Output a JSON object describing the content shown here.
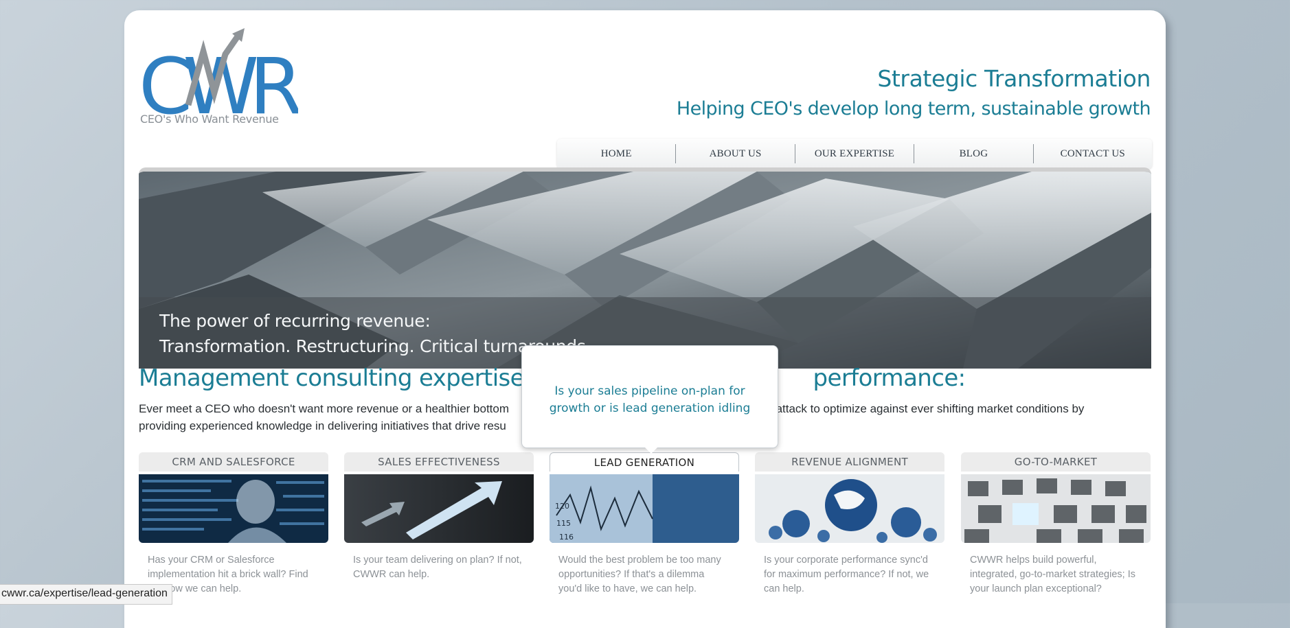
{
  "logo": {
    "letters": "CWR",
    "tagline": "CEO's Who Want Revenue"
  },
  "header": {
    "title": "Strategic Transformation",
    "subtitle": "Helping CEO's develop long term, sustainable growth"
  },
  "nav": {
    "items": [
      "HOME",
      "ABOUT US",
      "OUR EXPERTISE",
      "BLOG",
      "CONTACT US"
    ]
  },
  "banner": {
    "line1": "The power of recurring revenue:",
    "line2": "Transformation. Restructuring. Critical turnarounds"
  },
  "main": {
    "headline_left": "Management consulting expertise to op",
    "headline_right": "performance:",
    "intro_line1_left": "Ever meet a CEO who doesn't want more revenue or a healthier bottom",
    "intro_line1_right": "ne of attack to optimize against ever shifting market conditions by",
    "intro_line2": "providing experienced knowledge in delivering initiatives that drive resu"
  },
  "tooltip": {
    "text": "Is your sales pipeline on-plan for growth or is lead generation idling"
  },
  "services": [
    {
      "title": "CRM AND SALESFORCE",
      "text": "Has your CRM or Salesforce implementation hit a brick wall? Find out how we can help."
    },
    {
      "title": "SALES EFFECTIVENESS",
      "text": "Is your team delivering on plan? If not, CWWR can help."
    },
    {
      "title": "LEAD GENERATION",
      "text": "Would the best problem be too many opportunities? If that's a dilemma you'd like to have, we can help."
    },
    {
      "title": "REVENUE ALIGNMENT",
      "text": "Is your corporate performance sync'd for maximum performance? If not, we can help."
    },
    {
      "title": "GO-TO-MARKET",
      "text": "CWWR helps build powerful, integrated, go-to-market strategies; Is your launch plan exceptional?"
    }
  ],
  "status_bar": {
    "url": "cwwr.ca/expertise/lead-generation"
  },
  "colors": {
    "accent": "#1b7d94",
    "logo_blue": "#2f7fc1",
    "logo_gray": "#8a9096"
  }
}
